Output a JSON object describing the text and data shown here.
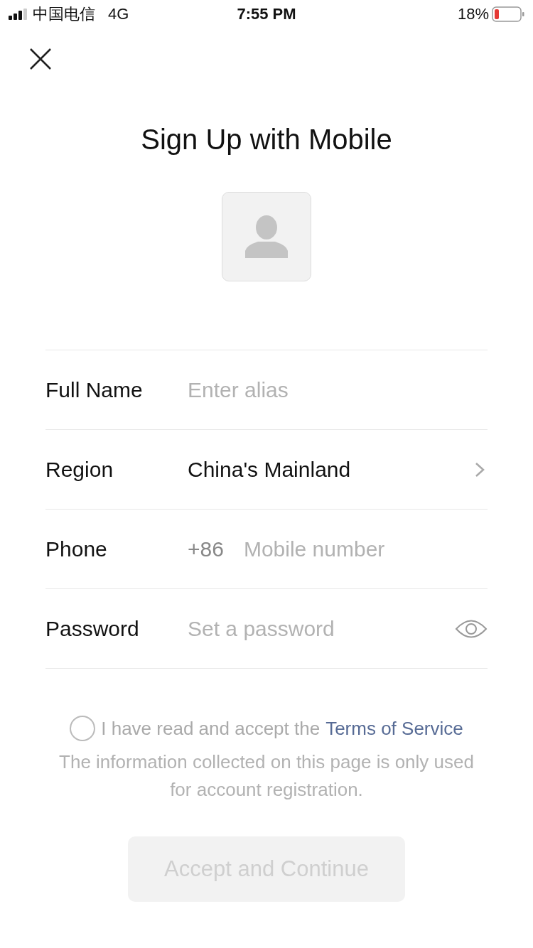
{
  "status_bar": {
    "carrier": "中国电信",
    "network": "4G",
    "time": "7:55 PM",
    "battery": "18%"
  },
  "title": "Sign Up with Mobile",
  "form": {
    "rows": [
      {
        "kind": "text",
        "label": "Full Name",
        "placeholder": "Enter alias"
      },
      {
        "kind": "select",
        "label": "Region",
        "value": "China's Mainland"
      },
      {
        "kind": "phone",
        "label": "Phone",
        "prefix": "+86",
        "placeholder": "Mobile number"
      },
      {
        "kind": "password",
        "label": "Password",
        "placeholder": "Set a password"
      }
    ]
  },
  "agreement": {
    "checked": false,
    "text": "I have read and accept the",
    "link": "Terms of Service"
  },
  "notice": "The information collected on this page is only used for account registration.",
  "button": {
    "label": "Accept and Continue",
    "disabled": true
  }
}
